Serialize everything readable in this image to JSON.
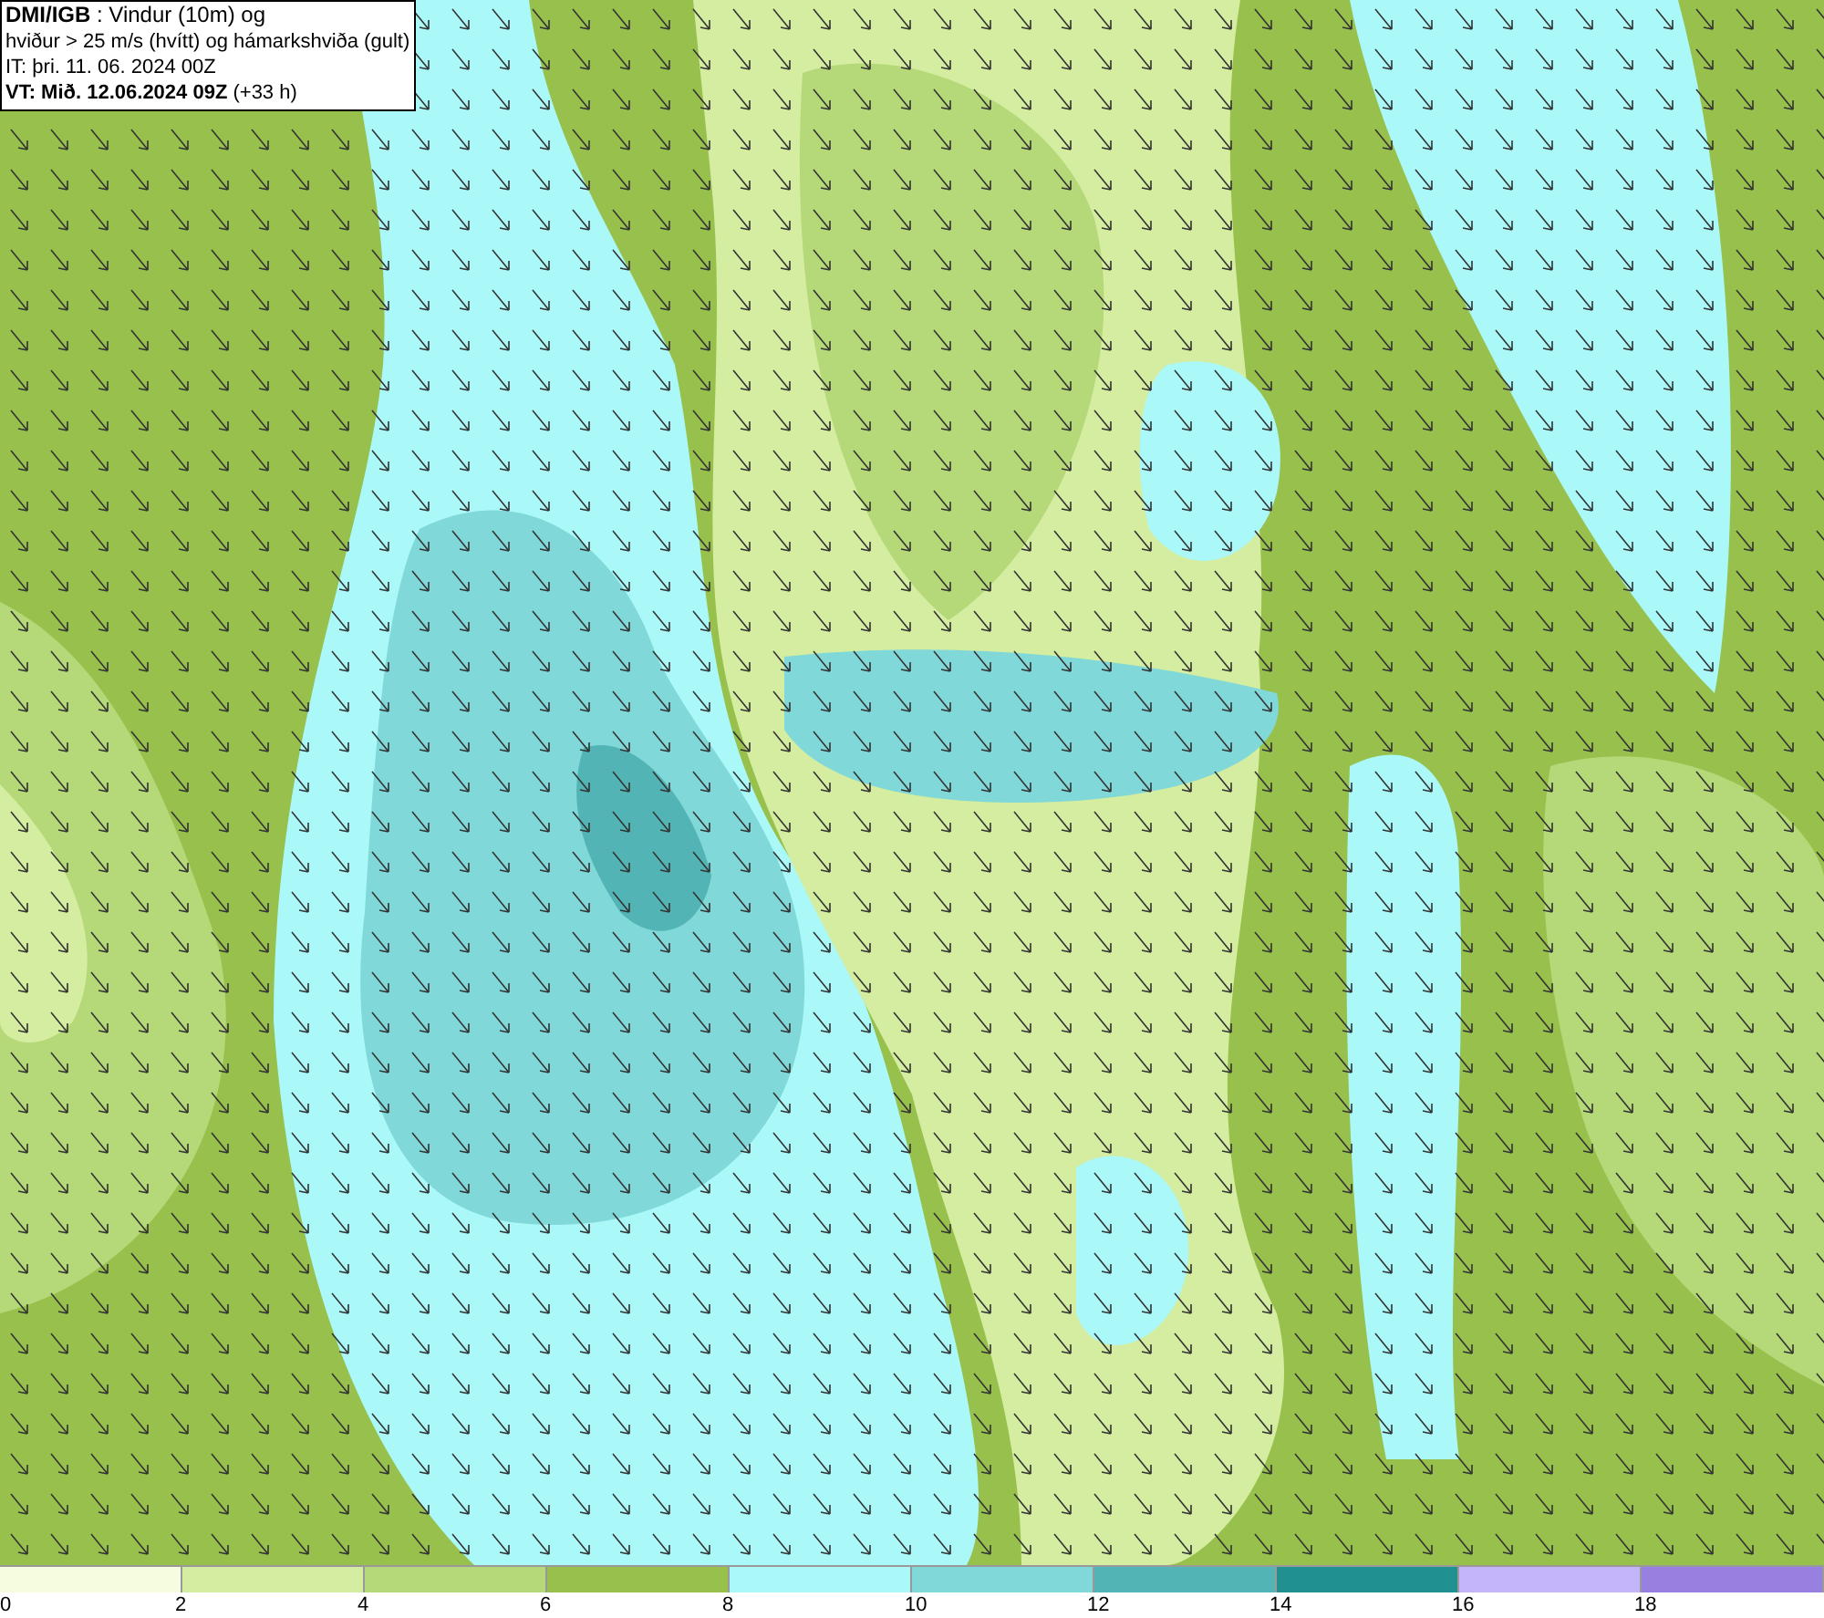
{
  "title_box": {
    "lines": [
      "**DMI/IGB** : Vindur (10m) og",
      "hviður > 25 m/s (hvítt) og hámarkshviða (gult)",
      "IT: þri. 11. 06. 2024 00Z",
      "**VT: Mið. 12.06.2024 09Z** (+33 h)"
    ]
  },
  "legend": {
    "bins": [
      {
        "label": "0",
        "color": "#f5fce0"
      },
      {
        "label": "2",
        "color": "#d4eda0"
      },
      {
        "label": "4",
        "color": "#b5d878"
      },
      {
        "label": "6",
        "color": "#98c04c"
      },
      {
        "label": "8",
        "color": "#aaf8f8"
      },
      {
        "label": "10",
        "color": "#80d8d8"
      },
      {
        "label": "12",
        "color": "#52b4b4"
      },
      {
        "label": "14",
        "color": "#219090"
      },
      {
        "label": "16",
        "color": "#c4b4f8"
      },
      {
        "label": "18",
        "color": "#9880e0"
      }
    ]
  }
}
